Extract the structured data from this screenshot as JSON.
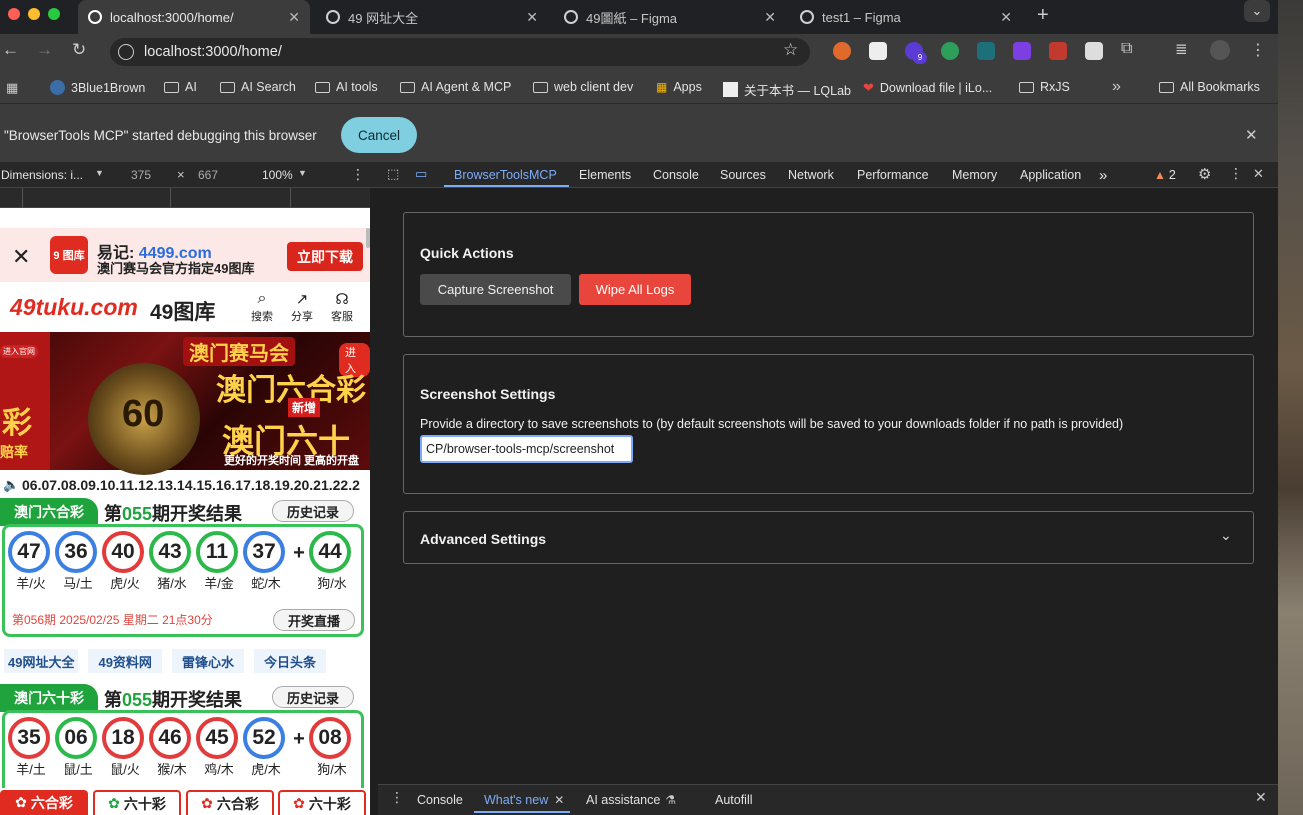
{
  "browser": {
    "tabs": [
      {
        "title": "localhost:3000/home/",
        "active": true
      },
      {
        "title": "49 网址大全",
        "active": false
      },
      {
        "title": "49圖紙 – Figma",
        "active": false
      },
      {
        "title": "test1 – Figma",
        "active": false
      }
    ],
    "new_tab": "+",
    "url": "localhost:3000/home/",
    "bookmarks": [
      "3Blue1Brown",
      "AI",
      "AI Search",
      "AI tools",
      "AI Agent & MCP",
      "web client dev",
      "Apps",
      "关于本书 — LQLab",
      "Download file | iLo...",
      "RxJS"
    ],
    "bookmarks_overflow": "»",
    "all_bookmarks": "All Bookmarks",
    "extension_badge": "9"
  },
  "infobar": {
    "message": "\"BrowserTools MCP\" started debugging this browser",
    "cancel": "Cancel"
  },
  "device_toolbar": {
    "dimensions": "Dimensions: i...",
    "width": "375",
    "x": "×",
    "height": "667",
    "zoom": "100%"
  },
  "mobile_page": {
    "ad": {
      "remember": "易记:",
      "domain": "4499.com",
      "subtitle": "澳门赛马会官方指定49图库",
      "download": "立即下载",
      "logo_text": "9 图库"
    },
    "header": {
      "logo": "49tuku.com",
      "title": "49图库",
      "search": "搜索",
      "share": "分享",
      "service": "客服"
    },
    "banner": {
      "enter_left": "进入官网",
      "top": "澳门赛马会",
      "big1": "澳门六合彩",
      "new": "新增",
      "big2": "澳门六十",
      "sub": "更好的开奖时间 更高的开盘",
      "badge": "60",
      "enter_right": "进入",
      "left_char": "彩",
      "left_small": "赔率"
    },
    "ticker": "06.07.08.09.10.11.12.13.14.15.16.17.18.19.20.21.22.2",
    "lottery1": {
      "name": "澳门六合彩",
      "title_prefix": "第",
      "period": "055",
      "title_suffix": "期开奖结果",
      "history": "历史记录",
      "balls": [
        {
          "n": "47",
          "z": "羊/火",
          "c": "blue"
        },
        {
          "n": "36",
          "z": "马/土",
          "c": "blue"
        },
        {
          "n": "40",
          "z": "虎/火",
          "c": "red"
        },
        {
          "n": "43",
          "z": "猪/水",
          "c": "green"
        },
        {
          "n": "11",
          "z": "羊/金",
          "c": "green"
        },
        {
          "n": "37",
          "z": "蛇/木",
          "c": "blue"
        }
      ],
      "plus": "+",
      "special": {
        "n": "44",
        "z": "狗/水",
        "c": "green"
      },
      "next": "第056期 2025/02/25 星期二 21点30分",
      "live": "开奖直播"
    },
    "links": [
      "49网址大全",
      "49资料网",
      "雷锋心水",
      "今日头条"
    ],
    "lottery2": {
      "name": "澳门六十彩",
      "title_prefix": "第",
      "period": "055",
      "title_suffix": "期开奖结果",
      "history": "历史记录",
      "balls": [
        {
          "n": "35",
          "z": "羊/土",
          "c": "red"
        },
        {
          "n": "06",
          "z": "鼠/土",
          "c": "green"
        },
        {
          "n": "18",
          "z": "鼠/火",
          "c": "red"
        },
        {
          "n": "46",
          "z": "猴/木",
          "c": "red"
        },
        {
          "n": "45",
          "z": "鸡/木",
          "c": "red"
        },
        {
          "n": "52",
          "z": "虎/木",
          "c": "blue"
        }
      ],
      "plus": "+",
      "special": {
        "n": "08",
        "z": "狗/木",
        "c": "red"
      }
    },
    "bottom_tabs": [
      "六合彩",
      "六十彩",
      "六合彩",
      "六十彩"
    ]
  },
  "devtools": {
    "tabs": [
      "BrowserToolsMCP",
      "Elements",
      "Console",
      "Sources",
      "Network",
      "Performance",
      "Memory",
      "Application"
    ],
    "overflow": "»",
    "warnings": "2",
    "quick_actions": {
      "title": "Quick Actions",
      "capture": "Capture Screenshot",
      "wipe": "Wipe All Logs"
    },
    "screenshot_settings": {
      "title": "Screenshot Settings",
      "description": "Provide a directory to save screenshots to (by default screenshots will be saved to your downloads folder if no path is provided)",
      "path_value": "CP/browser-tools-mcp/screenshot"
    },
    "advanced": {
      "title": "Advanced Settings"
    },
    "drawer_tabs": [
      "Console",
      "What's new",
      "AI assistance",
      "Autofill"
    ]
  },
  "colors": {
    "accent": "#7cacf8",
    "wipe_button": "#e8453c",
    "cancel_button": "#7fcfe0",
    "lottery_green": "#1fa33d",
    "ad_red": "#d9261c"
  }
}
